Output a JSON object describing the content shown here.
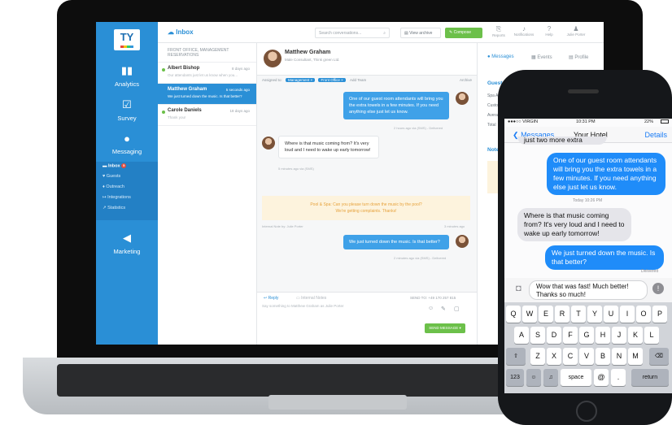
{
  "laptop": {
    "logo": "TY",
    "sidebar": [
      {
        "label": "Analytics",
        "icon": "chart-icon"
      },
      {
        "label": "Survey",
        "icon": "clipboard-icon"
      },
      {
        "label": "Messaging",
        "icon": "chat-icon"
      },
      {
        "label": "Marketing",
        "icon": "megaphone-icon"
      }
    ],
    "subnav": [
      {
        "label": "Inbox",
        "badge": "5"
      },
      {
        "label": "Guests"
      },
      {
        "label": "Outreach"
      },
      {
        "label": "Integrations"
      },
      {
        "label": "Statistics"
      }
    ],
    "topbar": {
      "title": "Inbox",
      "search_placeholder": "Search conversations...",
      "archive": "View archive",
      "compose": "Compose",
      "icons": [
        "Reports",
        "Notifications",
        "Help",
        "Julie Porter"
      ]
    },
    "conv_header": "FRONT OFFICE, MANAGEMENT RESERVATIONS",
    "conversations": [
      {
        "name": "Albert Bishop",
        "time": "8 days ago",
        "preview": "Our attendants just let us know when you..."
      },
      {
        "name": "Matthew Graham",
        "time": "5 seconds ago",
        "preview": "We just turned down the music. Is that better?"
      },
      {
        "name": "Carole Daniels",
        "time": "18 days ago",
        "preview": "Thank you!"
      }
    ],
    "chat": {
      "name": "Matthew Graham",
      "subtitle": "Male Consultant, Think green Ltd.",
      "assigned_label": "Assigned to:",
      "tags": [
        "Management ×",
        "Front Office ×"
      ],
      "add_team": "Add Team",
      "archive": "Archive",
      "messages": [
        {
          "text": "One of our guest room attendants will bring you the extra towels in a few minutes. If you need anything else just let us know.",
          "meta": "2 hours ago via (SMS) - Delivered"
        },
        {
          "text": "Where is that music coming from? It's very loud and I need to wake up early tomorrow!",
          "meta": "5 minutes ago via (SMS)"
        },
        {
          "text": "We just turned down the music. Is that better?",
          "meta": "2 minutes ago via (SMS) - Delivered"
        }
      ],
      "note_line1": "Pool & Spa: Can you please turn down the music by the pool?",
      "note_line2": "We're getting complaints. Thanks!",
      "note_meta": "Internal Note by: Julie Porter",
      "note_time": "3 minutes ago",
      "reply_tab": "Reply",
      "internal_tab": "Internal Notes",
      "send_to": "SEND TO: +49 170 257 815",
      "reply_placeholder": "Say something to Matthew Graham as Julie Porter",
      "send_button": "SEND MESSAGE"
    },
    "guest_panel": {
      "tabs": [
        "Messages",
        "Events",
        "Profile"
      ],
      "heading": "Guest",
      "fields": [
        "Spa Ap",
        "Custo",
        "Avera",
        "Total"
      ],
      "notes": "Notes"
    }
  },
  "phone": {
    "carrier": "●●●○○ VIRGIN",
    "time": "10:31 PM",
    "battery": "22%",
    "back": "Messages",
    "title": "Your Hotel",
    "details": "Details",
    "top_fragment": "just two more extra towels",
    "messages": [
      {
        "text": "One of our guest room attendants will bring you the extra towels in a few minutes. If you need anything else just let us know."
      },
      {
        "text": "Where is that music coming from? It's very loud and I need to wake up early tomorrow!"
      },
      {
        "text": "We just turned down the music. Is that better?"
      }
    ],
    "timestamp": "Today 10:26 PM",
    "delivered": "Delivered",
    "composer_text": "Wow that was fast! Much better! Thanks so much!",
    "keys_row1": [
      "Q",
      "W",
      "E",
      "R",
      "T",
      "Y",
      "U",
      "I",
      "O",
      "P"
    ],
    "keys_row2": [
      "A",
      "S",
      "D",
      "F",
      "G",
      "H",
      "J",
      "K",
      "L"
    ],
    "keys_row3": [
      "Z",
      "X",
      "C",
      "V",
      "B",
      "N",
      "M"
    ],
    "key_123": "123",
    "key_space": "space",
    "key_at": "@",
    "key_dot": ".",
    "key_return": "return"
  }
}
